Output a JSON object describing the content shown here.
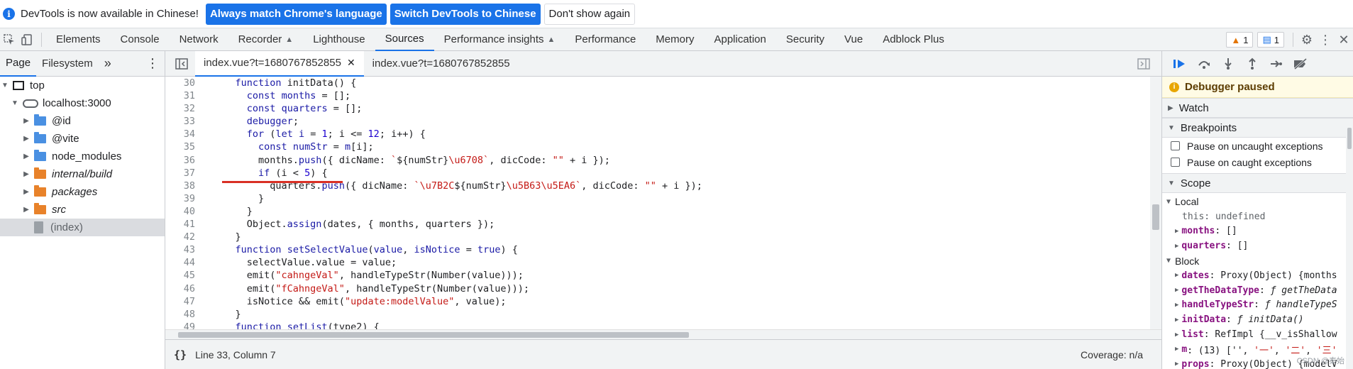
{
  "infobar": {
    "message": "DevTools is now available in Chinese!",
    "btn_match": "Always match Chrome's language",
    "btn_switch": "Switch DevTools to Chinese",
    "btn_dismiss": "Don't show again"
  },
  "toolbar": {
    "tabs": [
      "Elements",
      "Console",
      "Network",
      "Recorder",
      "Lighthouse",
      "Sources",
      "Performance insights",
      "Performance",
      "Memory",
      "Application",
      "Security",
      "Vue",
      "Adblock Plus"
    ],
    "active_tab": "Sources",
    "warnings_count": "1",
    "issues_count": "1"
  },
  "navigator": {
    "tabs": [
      "Page",
      "Filesystem"
    ],
    "more": "»",
    "tree": [
      "top",
      "localhost:3000",
      "@id",
      "@vite",
      "node_modules",
      "internal/build",
      "packages",
      "src",
      "(index)"
    ]
  },
  "editor": {
    "tabs": [
      "index.vue?t=1680767852855",
      "index.vue?t=1680767852855"
    ],
    "status_position": "Line 33, Column 7",
    "status_coverage": "Coverage: n/a"
  },
  "debugger": {
    "paused_label": "Debugger paused",
    "panes": {
      "watch": "Watch",
      "breakpoints": "Breakpoints",
      "scope": "Scope"
    },
    "pause_uncaught": "Pause on uncaught exceptions",
    "pause_caught": "Pause on caught exceptions",
    "local_label": "Local",
    "block_label": "Block"
  },
  "watermark": "CSDN @秦始"
}
